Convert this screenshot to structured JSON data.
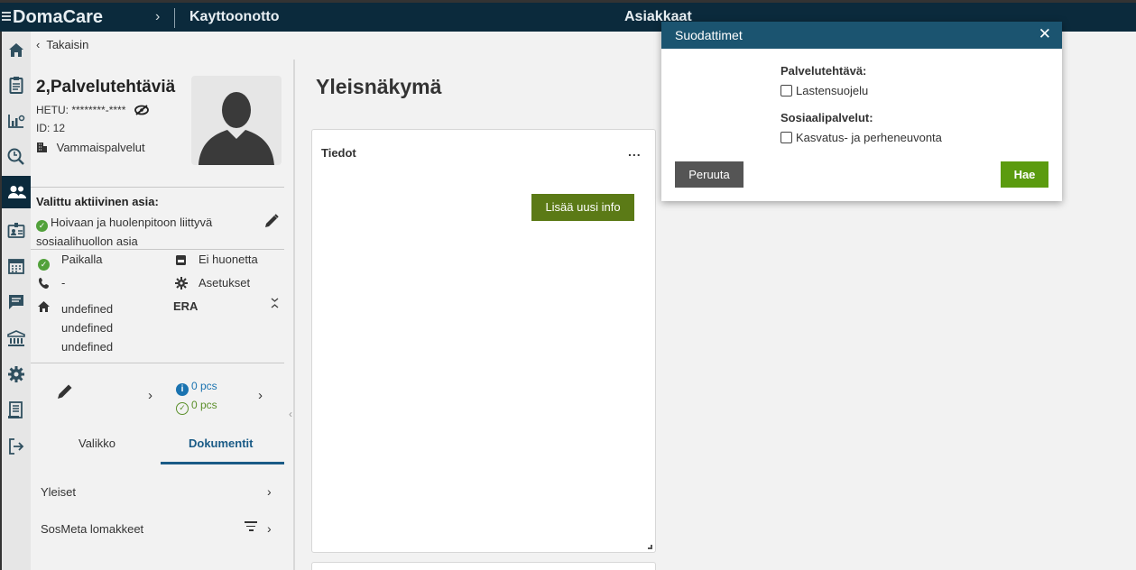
{
  "header": {
    "app_name": "DomaCare",
    "breadcrumb_arrow": "›",
    "module": "Kayttoonotto",
    "section": "Asiakkaat"
  },
  "nav": {
    "back_label": "Takaisin"
  },
  "profile": {
    "name": "2,Palvelutehtäviä",
    "hetu": "HETU: ********-****",
    "id": "ID: 12",
    "unit": "Vammaispalvelut",
    "active_case_title": "Valittu aktiivinen asia:",
    "active_case": "Hoivaan ja huolenpitoon liittyvä sosiaalihuollon asia",
    "presence": "Paikalla",
    "room": "Ei huonetta",
    "phone": "-",
    "settings": "Asetukset",
    "address_lines": [
      "undefined",
      "undefined",
      "undefined"
    ],
    "era": "ERA",
    "info_count": "0 pcs",
    "done_count": "0 pcs"
  },
  "tabs": [
    {
      "label": "Valikko",
      "active": false
    },
    {
      "label": "Dokumentit",
      "active": true
    }
  ],
  "documents": [
    {
      "label": "Yleiset"
    },
    {
      "label": "SosMeta lomakkeet"
    }
  ],
  "overview": {
    "title": "Yleisnäkymä",
    "card_title": "Tiedot",
    "card_menu": "...",
    "add_button": "Lisää uusi info"
  },
  "modal": {
    "title": "Suodattimet",
    "close": "✕",
    "groups": [
      {
        "title": "Palvelutehtävä:",
        "option": "Lastensuojelu",
        "checked": false
      },
      {
        "title": "Sosiaalipalvelut:",
        "option": "Kasvatus- ja perheneuvonta",
        "checked": false
      }
    ],
    "cancel_label": "Peruuta",
    "search_label": "Hae"
  },
  "colors": {
    "topbar": "#0b2a3c",
    "modal_header": "#1b5470",
    "primary_green": "#5b9b0f",
    "add_button": "#5b7a16",
    "tab_active": "#1a5b86"
  },
  "icons": {
    "rail": [
      "home-icon",
      "clipboard-icon",
      "chart-icon",
      "clock-search-icon",
      "people-icon",
      "id-badge-icon",
      "calendar-icon",
      "message-icon",
      "bank-icon",
      "gear-icon",
      "document-icon",
      "logout-icon"
    ]
  }
}
